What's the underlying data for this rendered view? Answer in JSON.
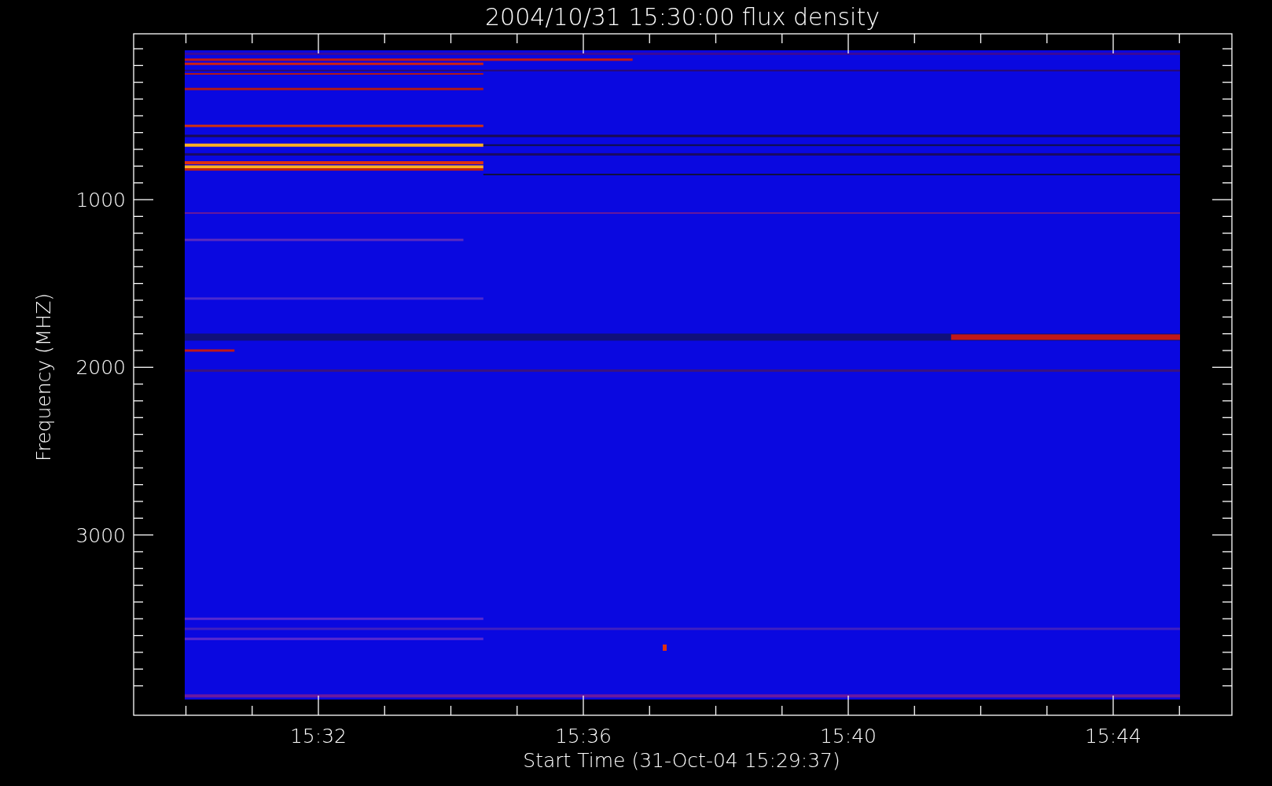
{
  "plot": {
    "title": "2004/10/31 15:30:00 flux density",
    "xlabel": "Start Time (31-Oct-04 15:29:37)",
    "ylabel": "Frequency (MHZ)",
    "xticks": [
      "15:32",
      "15:36",
      "15:40",
      "15:44"
    ],
    "yticks": [
      "1000",
      "2000",
      "3000"
    ]
  }
}
